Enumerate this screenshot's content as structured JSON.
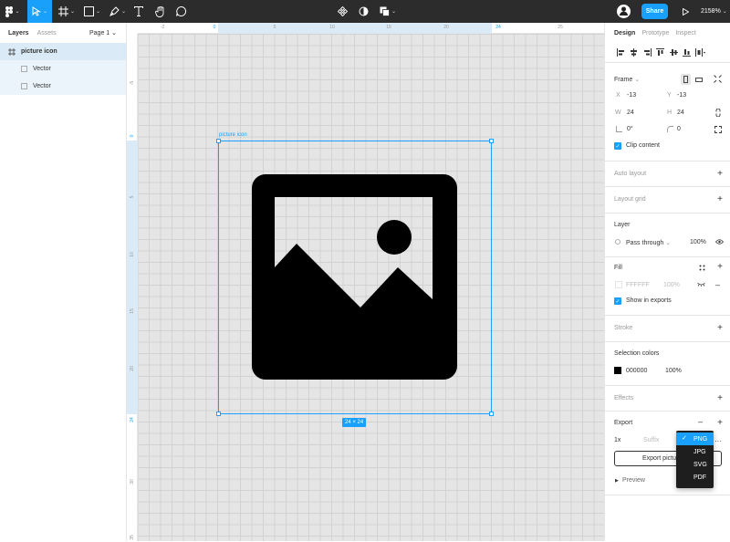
{
  "toolbar": {
    "tools": [
      {
        "name": "main-menu",
        "icon": "figma-logo-icon"
      },
      {
        "name": "move-tool",
        "icon": "move-arrow-icon",
        "active": true
      },
      {
        "name": "frame-tool",
        "icon": "frame-hash-icon"
      },
      {
        "name": "shape-tool",
        "icon": "rectangle-icon"
      },
      {
        "name": "pen-tool",
        "icon": "pen-icon"
      },
      {
        "name": "text-tool",
        "icon": "text-icon"
      },
      {
        "name": "hand-tool",
        "icon": "hand-icon"
      },
      {
        "name": "comment-tool",
        "icon": "comment-icon"
      }
    ],
    "center_tools": [
      "component-icon",
      "contrast-icon",
      "boolean-icon"
    ],
    "share_label": "Share",
    "zoom_label": "2158%",
    "accent_color": "#18a0fb"
  },
  "left_panel": {
    "tabs": [
      "Layers",
      "Assets"
    ],
    "page_label": "Page 1",
    "layers": [
      {
        "label": "picture icon",
        "type": "frame"
      },
      {
        "label": "Vector",
        "type": "vector"
      },
      {
        "label": "Vector",
        "type": "vector"
      }
    ]
  },
  "rulers": {
    "top": [
      "-2",
      "0",
      "5",
      "10",
      "15",
      "20",
      "24",
      "25"
    ],
    "left": [
      "-5",
      "0",
      "5",
      "10",
      "15",
      "20",
      "24",
      "30",
      "35"
    ]
  },
  "canvas": {
    "frame_label": "picture icon",
    "size_badge": "24 × 24"
  },
  "right_panel": {
    "tabs": [
      "Design",
      "Prototype",
      "Inspect"
    ],
    "frame": {
      "title": "Frame",
      "x_label": "X",
      "x_value": "-13",
      "y_label": "Y",
      "y_value": "-13",
      "w_label": "W",
      "w_value": "24",
      "h_label": "H",
      "h_value": "24",
      "rotation": "0°",
      "radius": "0",
      "clip_label": "Clip content"
    },
    "auto_layout": "Auto layout",
    "layout_grid": "Layout grid",
    "layer": {
      "title": "Layer",
      "blend": "Pass through",
      "opacity": "100%"
    },
    "fill": {
      "title": "Fill",
      "hex": "FFFFFF",
      "opacity": "100%",
      "show_in_exports": "Show in exports"
    },
    "stroke": "Stroke",
    "selection_colors": {
      "title": "Selection colors",
      "hex": "000000",
      "opacity": "100%",
      "color": "#000000"
    },
    "effects": "Effects",
    "export": {
      "title": "Export",
      "scale": "1x",
      "suffix_placeholder": "Suffix",
      "button_label": "Export picture icon",
      "preview_label": "Preview",
      "format_options": [
        "PNG",
        "JPG",
        "SVG",
        "PDF"
      ],
      "selected_format": "PNG"
    }
  }
}
